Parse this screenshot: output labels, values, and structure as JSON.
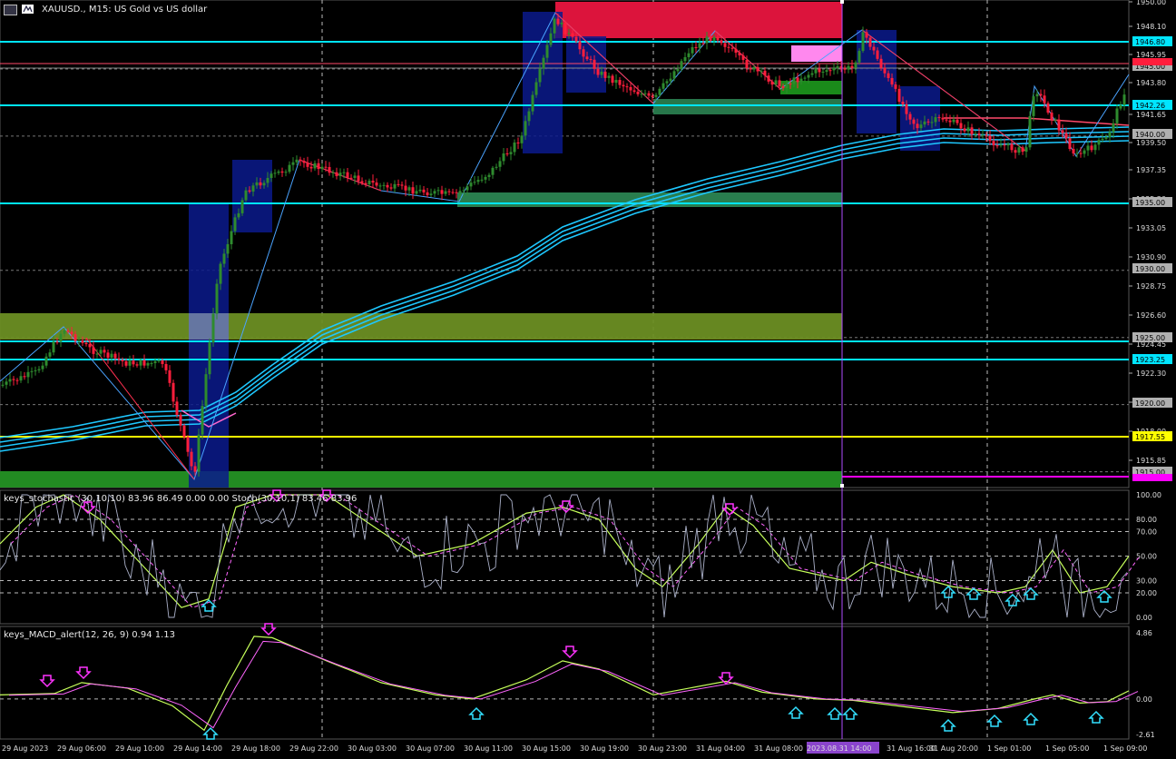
{
  "header": {
    "symbol_line": "XAUUSD., M15: US Gold vs US dollar"
  },
  "indicators": {
    "stoch_label": "keys_stochastic (30,10,10) 83.96 86.49 0.00 0.00 Stoch(30,10,1) 83.46 83.96",
    "macd_label": "keys_MACD_alert(12, 26, 9) 0.94 1.13"
  },
  "price_axis": {
    "ticks": [
      "1950.00",
      "1948.10",
      "1945.95",
      "1943.80",
      "1941.65",
      "1939.50",
      "1937.35",
      "1935.20",
      "1933.05",
      "1930.90",
      "1928.75",
      "1926.60",
      "1924.45",
      "1922.30",
      "1920.15",
      "1918.00",
      "1915.85"
    ],
    "tags": [
      {
        "text": "1946.80",
        "color": "#00e5ff",
        "fg": "#000"
      },
      {
        "text": "1945.00",
        "color": "#b0b0b0",
        "fg": "#000"
      },
      {
        "text": "1942.26",
        "color": "#00e5ff",
        "fg": "#000"
      },
      {
        "text": "1940.00",
        "color": "#b0b0b0",
        "fg": "#000"
      },
      {
        "text": "1935.00",
        "color": "#b0b0b0",
        "fg": "#000"
      },
      {
        "text": "1930.00",
        "color": "#b0b0b0",
        "fg": "#000"
      },
      {
        "text": "1925.00",
        "color": "#b0b0b0",
        "fg": "#000"
      },
      {
        "text": "1923.25",
        "color": "#00e5ff",
        "fg": "#000"
      },
      {
        "text": "1920.00",
        "color": "#b0b0b0",
        "fg": "#000"
      },
      {
        "text": "1917.55",
        "color": "#ffff00",
        "fg": "#000"
      },
      {
        "text": "1915.00",
        "color": "#b0b0b0",
        "fg": "#000"
      }
    ]
  },
  "stoch_axis": [
    "100.00",
    "80.00",
    "70.00",
    "50.00",
    "30.00",
    "20.00",
    "0.00"
  ],
  "macd_axis": [
    "4.86",
    "0.00",
    "-2.61"
  ],
  "time_axis": [
    "29 Aug 2023",
    "29 Aug 06:00",
    "29 Aug 10:00",
    "29 Aug 14:00",
    "29 Aug 18:00",
    "29 Aug 22:00",
    "30 Aug 03:00",
    "30 Aug 07:00",
    "30 Aug 11:00",
    "30 Aug 15:00",
    "30 Aug 19:00",
    "30 Aug 23:00",
    "31 Aug 04:00",
    "31 Aug 08:00",
    "2023.08.31 14:00",
    "31 Aug 16:00",
    "31 Aug 20:00",
    "1 Sep 01:00",
    "1 Sep 05:00",
    "1 Sep 09:00"
  ],
  "colors": {
    "bull": "#2e8b2e",
    "bear": "#ff1e3c",
    "cyan_line": "#00e5ff",
    "yellow_line": "#ffff00",
    "ma": "#1ec8ff",
    "olive_zone": "#6b8e23",
    "green_zone": "#228b22",
    "red_zone": "#dc143c",
    "blue_box": "#0a1a8c",
    "pink_box": "#ff88ee",
    "cursor": "#b04dff"
  }
}
